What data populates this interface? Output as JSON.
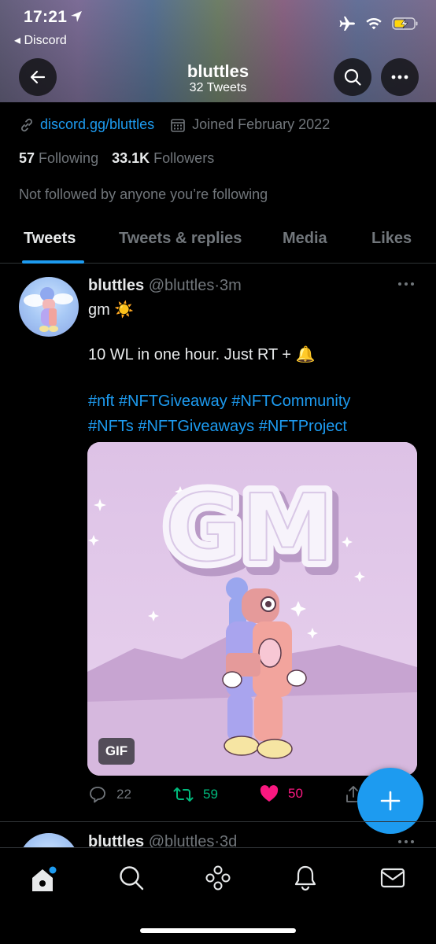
{
  "status_bar": {
    "time": "17:21",
    "back_app": "◂ Discord"
  },
  "header": {
    "title": "bluttles",
    "subtitle": "32 Tweets"
  },
  "profile": {
    "link": "discord.gg/bluttles",
    "joined": "Joined February 2022",
    "following_count": "57",
    "following_label": "Following",
    "followers_count": "33.1K",
    "followers_label": "Followers",
    "not_followed": "Not followed by anyone you’re following"
  },
  "tabs": [
    {
      "label": "Tweets",
      "active": true
    },
    {
      "label": "Tweets & replies",
      "active": false
    },
    {
      "label": "Media",
      "active": false
    },
    {
      "label": "Likes",
      "active": false
    }
  ],
  "tweet": {
    "name": "bluttles",
    "handle": "@bluttles",
    "time": "3m",
    "line1": "gm ☀️",
    "line2": "10 WL in one hour. Just RT + 🔔",
    "hashtags_line1": "#nft #NFTGiveaway #NFTCommunity",
    "hashtags_line2": "#NFTs #NFTGiveaways #NFTProject",
    "media_text": "GM",
    "media_badge": "GIF",
    "replies": "22",
    "retweets": "59",
    "likes": "50"
  },
  "tweet2": {
    "name": "bluttles",
    "handle": "@bluttles",
    "time": "3d"
  },
  "colors": {
    "accent": "#1d9bf0",
    "retweet": "#00ba7c",
    "like": "#f91880",
    "muted": "#71767b"
  }
}
